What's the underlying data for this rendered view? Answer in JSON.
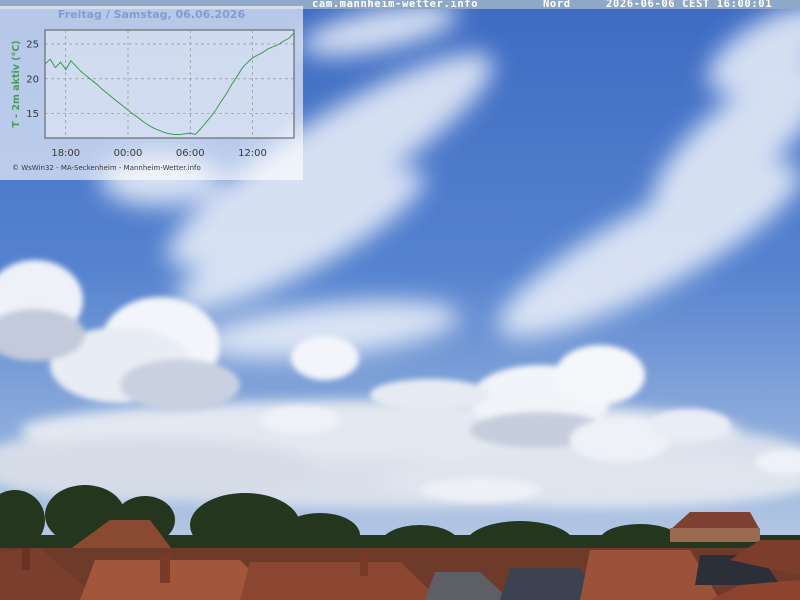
{
  "header": {
    "site": "cam.mannheim-wetter.info",
    "direction": "Nord",
    "timestamp": "2026-06-06 CEST 16:00:01"
  },
  "overlay": {
    "credit": "© WsWin32 - MA-Seckenheim - Mannheim-Wetter.info"
  },
  "chart_data": {
    "type": "line",
    "title": "Freitag / Samstag, 06.06.2026",
    "ylabel": "T - 2m aktiv (°C)",
    "xlabel": "",
    "ylim": [
      11.5,
      27
    ],
    "yticks": [
      15,
      20,
      25
    ],
    "xticks": [
      "18:00",
      "00:00",
      "06:00",
      "12:00"
    ],
    "xtick_hours": [
      2,
      8,
      14,
      20
    ],
    "xlim_hours": [
      0,
      24
    ],
    "grid": true,
    "series": [
      {
        "color": "#3d9b4e",
        "x": [
          0,
          0.5,
          1,
          1.5,
          2,
          2.5,
          3,
          3.5,
          4,
          4.5,
          5,
          5.5,
          6,
          6.5,
          7,
          7.5,
          8,
          8.5,
          9,
          9.5,
          10,
          10.5,
          11,
          11.5,
          12,
          12.5,
          13,
          13.5,
          14,
          14.5,
          15,
          15.5,
          16,
          16.5,
          17,
          17.5,
          18,
          18.5,
          19,
          19.5,
          20,
          20.5,
          21,
          21.5,
          22,
          22.5,
          23,
          23.5,
          24
        ],
        "y": [
          22.1,
          22.8,
          21.6,
          22.4,
          21.3,
          22.6,
          21.8,
          21.0,
          20.4,
          19.8,
          19.2,
          18.5,
          17.9,
          17.3,
          16.7,
          16.1,
          15.5,
          14.9,
          14.4,
          13.8,
          13.3,
          12.9,
          12.6,
          12.3,
          12.1,
          12.0,
          12.0,
          12.1,
          12.2,
          12.0,
          12.8,
          13.7,
          14.6,
          15.6,
          16.8,
          17.9,
          19.2,
          20.3,
          21.5,
          22.3,
          23.0,
          23.4,
          23.8,
          24.3,
          24.6,
          24.9,
          25.4,
          25.8,
          26.6
        ]
      }
    ]
  }
}
